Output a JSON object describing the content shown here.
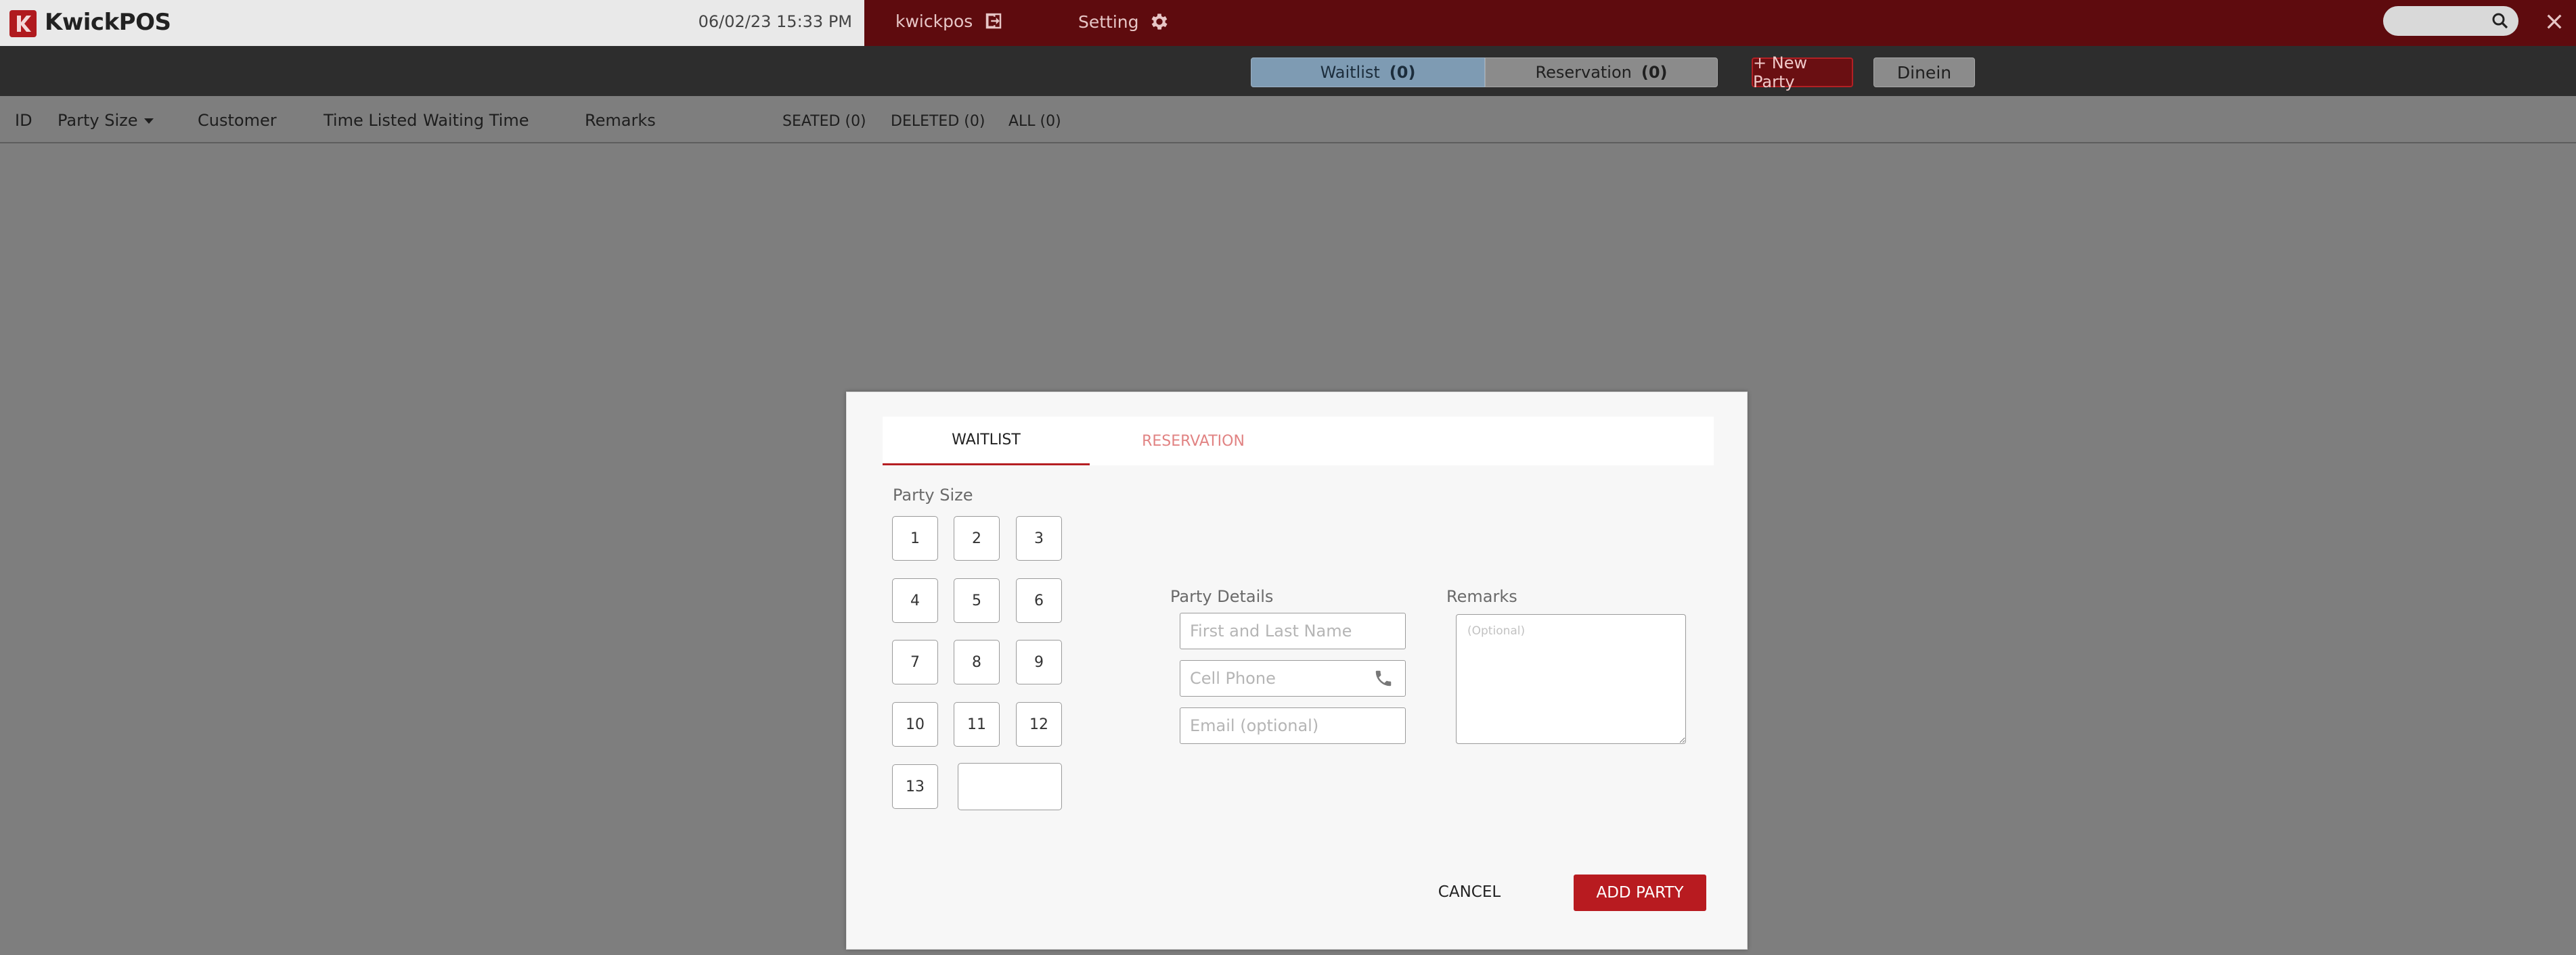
{
  "header": {
    "brand": "KwickPOS",
    "datetime": "06/02/23 15:33 PM",
    "user": "kwickpos",
    "setting_label": "Setting"
  },
  "toolbar": {
    "waitlist_label": "Waitlist",
    "waitlist_count": "(0)",
    "reservation_label": "Reservation",
    "reservation_count": "(0)",
    "new_party_label": "+ New Party",
    "dinein_label": "Dinein"
  },
  "columns": {
    "id": "ID",
    "party_size": "Party Size",
    "customer": "Customer",
    "time_listed": "Time Listed",
    "waiting_time": "Waiting Time",
    "remarks": "Remarks"
  },
  "filters": {
    "seated": "SEATED (0)",
    "deleted": "DELETED (0)",
    "all": "ALL (0)"
  },
  "modal": {
    "tabs": {
      "waitlist": "WAITLIST",
      "reservation": "RESERVATION"
    },
    "party_size_label": "Party Size",
    "party_sizes": [
      "1",
      "2",
      "3",
      "4",
      "5",
      "6",
      "7",
      "8",
      "9",
      "10",
      "11",
      "12",
      "13"
    ],
    "party_details_label": "Party Details",
    "name_placeholder": "First and Last Name",
    "phone_placeholder": "Cell Phone",
    "email_placeholder": "Email (optional)",
    "remarks_label": "Remarks",
    "remarks_placeholder": "(Optional)",
    "cancel_label": "CANCEL",
    "add_label": "ADD PARTY"
  },
  "colors": {
    "brand_red": "#b51f23",
    "header_dark_red": "#5e0b0e",
    "waitlist_active": "#7e9bb3"
  }
}
